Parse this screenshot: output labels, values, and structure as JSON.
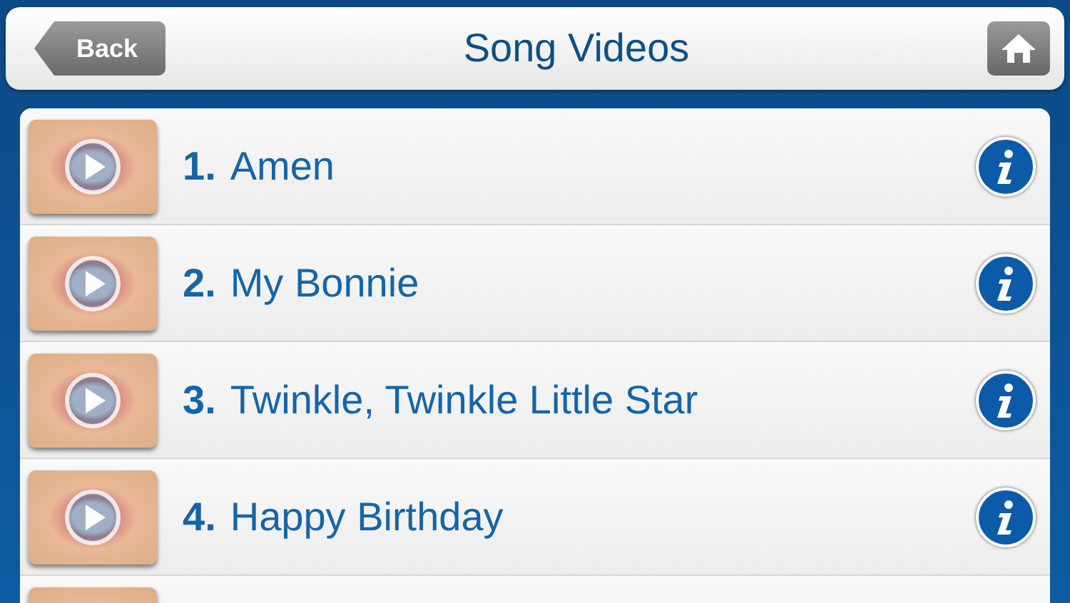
{
  "header": {
    "back": "Back",
    "title": "Song Videos"
  },
  "rows": [
    {
      "number": "1.",
      "title": "Amen"
    },
    {
      "number": "2.",
      "title": "My Bonnie"
    },
    {
      "number": "3.",
      "title": "Twinkle, Twinkle Little Star"
    },
    {
      "number": "4.",
      "title": "Happy Birthday"
    }
  ],
  "partial_row_visible": true
}
